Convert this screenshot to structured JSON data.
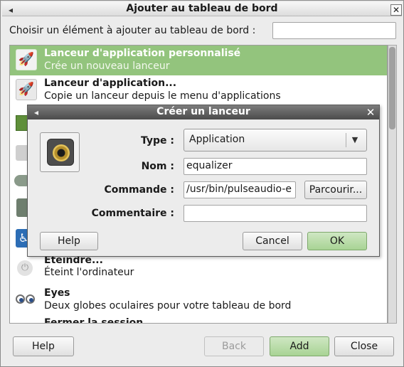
{
  "window": {
    "title": "Ajouter au tableau de bord",
    "prompt_label": "Choisir un élément à ajouter au tableau de bord :",
    "search_value": ""
  },
  "list": {
    "items": [
      {
        "title": "Lanceur d'application personnalisé",
        "desc": "Crée un nouveau lanceur",
        "icon": "rocket-icon",
        "selected": true
      },
      {
        "title": "Lanceur d'application...",
        "desc": "Copie un lanceur depuis le menu d'applications",
        "icon": "rocket-icon",
        "selected": false
      },
      {
        "title": "Éteindre...",
        "desc": "Éteint l'ordinateur",
        "icon": "power-icon",
        "selected": false
      },
      {
        "title": "Eyes",
        "desc": "Deux globes oculaires pour votre tableau de bord",
        "icon": "eyes-icon",
        "selected": false
      },
      {
        "title": "Fermer la session",
        "desc": "",
        "icon": "logout-icon",
        "selected": false
      }
    ]
  },
  "buttons": {
    "help": "Help",
    "back": "Back",
    "add": "Add",
    "close": "Close"
  },
  "dialog": {
    "title": "Créer un lanceur",
    "type_label": "Type :",
    "type_value": "Application",
    "name_label": "Nom :",
    "name_value": "equalizer",
    "command_label": "Commande :",
    "command_value": "/usr/bin/pulseaudio-e",
    "browse_label": "Parcourir...",
    "comment_label": "Commentaire :",
    "comment_value": "",
    "help_label": "Help",
    "cancel_label": "Cancel",
    "ok_label": "OK"
  },
  "colors": {
    "selection": "#93c47d",
    "ok_button": "#a8d394",
    "dialog_title": "#4b4b4b"
  }
}
